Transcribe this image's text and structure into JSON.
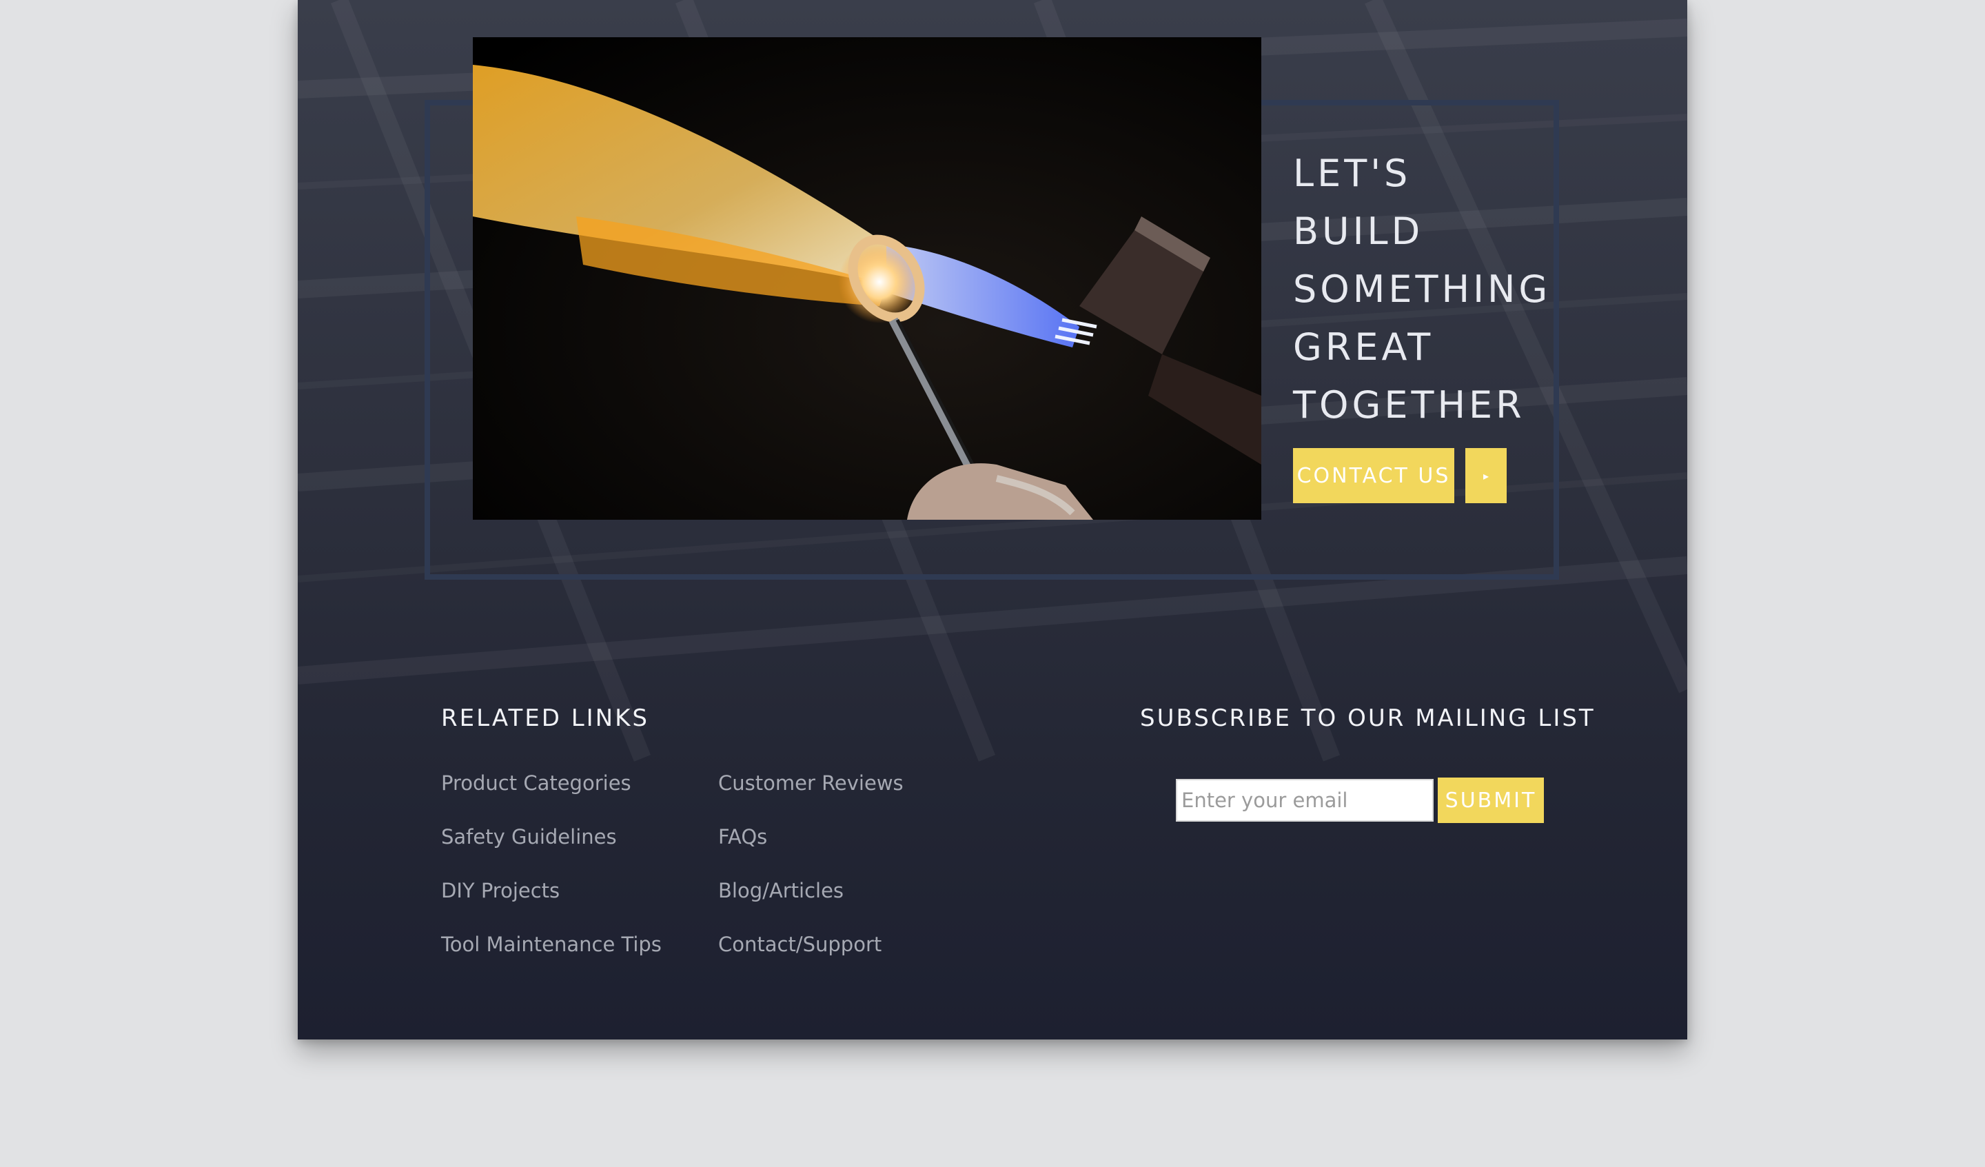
{
  "colors": {
    "page_background": "#e1e2e4",
    "panel": "#2d303d",
    "frame_border": "#2f3a52",
    "accent_yellow": "#f2d75c",
    "heading_text": "#e8eaf0",
    "link_text": "#a6a9b3"
  },
  "cta": {
    "heading_lines": [
      "LET'S",
      "BUILD",
      "SOMETHING",
      "GREAT",
      "TOGETHER"
    ],
    "contact_button_label": "CONTACT US",
    "arrow_icon": "play-triangle-icon",
    "arrow_glyph": "▸",
    "photo_subject": "glassblowing-torch-flame"
  },
  "footer": {
    "related_links_title": "RELATED LINKS",
    "links_column_1": [
      {
        "label": "Product Categories"
      },
      {
        "label": "Safety Guidelines"
      },
      {
        "label": "DIY Projects"
      },
      {
        "label": "Tool Maintenance Tips"
      }
    ],
    "links_column_2": [
      {
        "label": "Customer Reviews"
      },
      {
        "label": "FAQs"
      },
      {
        "label": "Blog/Articles"
      },
      {
        "label": "Contact/Support"
      }
    ],
    "subscribe_title": "SUBSCRIBE TO OUR MAILING LIST",
    "email_placeholder": "Enter your email",
    "email_value": "",
    "submit_label": "SUBMIT"
  }
}
